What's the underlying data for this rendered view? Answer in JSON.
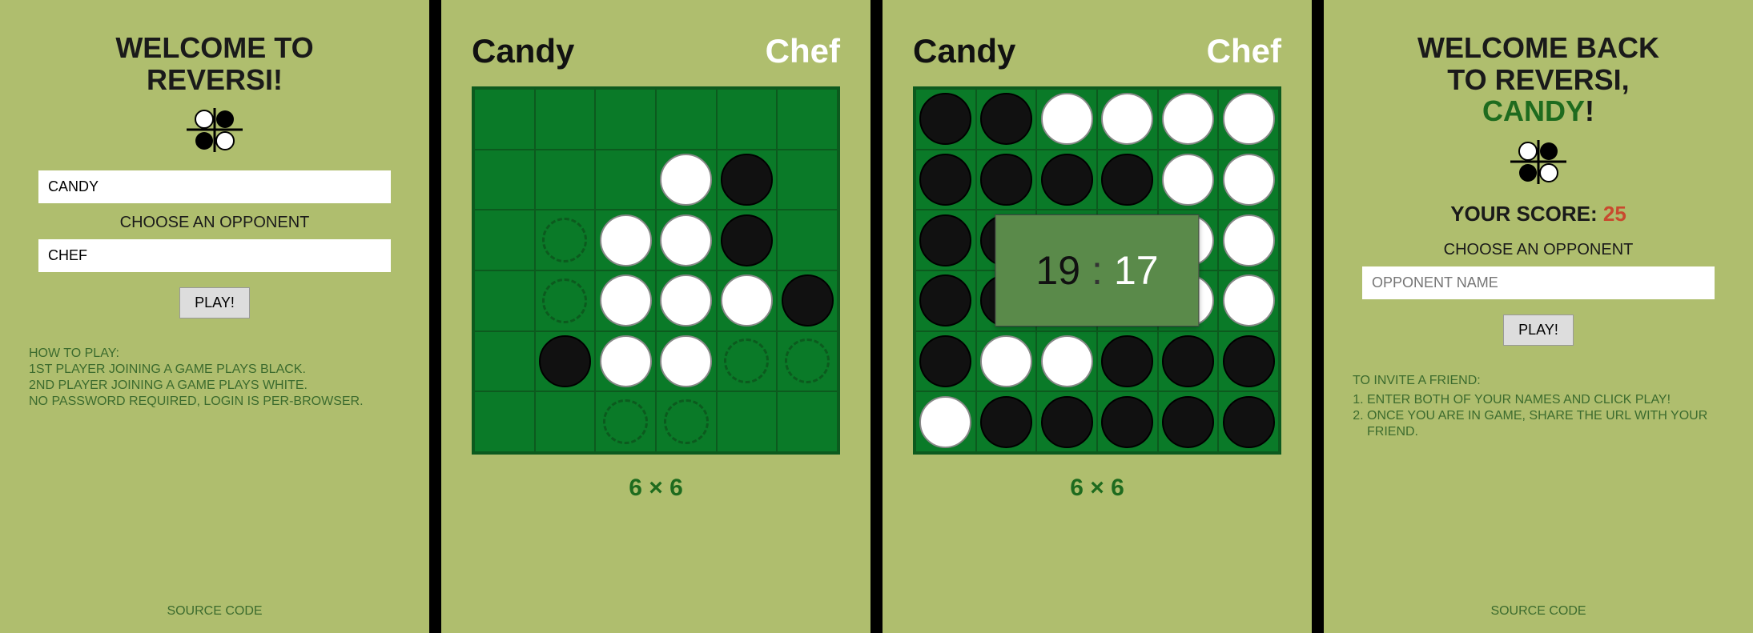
{
  "panel1": {
    "title_l1": "WELCOME TO",
    "title_l2": "REVERSI!",
    "name_value": "CANDY",
    "choose_label": "CHOOSE AN OPPONENT",
    "opp_value": "CHEF",
    "play_label": "PLAY!",
    "howto_title": "HOW TO PLAY:",
    "howto_l1": "1ST PLAYER JOINING A GAME PLAYS BLACK.",
    "howto_l2": "2ND PLAYER JOINING A GAME PLAYS WHITE.",
    "howto_l3": "NO PASSWORD REQUIRED, LOGIN IS PER-BROWSER.",
    "source": "SOURCE CODE"
  },
  "panel2": {
    "p1": "Candy",
    "p2": "Chef",
    "size": "6 × 6",
    "board": [
      [
        "",
        "",
        "",
        "",
        "",
        ""
      ],
      [
        "",
        "",
        "",
        "W",
        "B",
        ""
      ],
      [
        "",
        "h",
        "W",
        "W",
        "B",
        ""
      ],
      [
        "",
        "h",
        "W",
        "W",
        "W",
        "B"
      ],
      [
        "",
        "B",
        "W",
        "W",
        "h",
        "h"
      ],
      [
        "",
        "",
        "h",
        "h",
        "",
        ""
      ]
    ]
  },
  "panel3": {
    "p1": "Candy",
    "p2": "Chef",
    "size": "6 × 6",
    "score1": "19",
    "score2": "17",
    "board": [
      [
        "B",
        "B",
        "W",
        "W",
        "W",
        "W"
      ],
      [
        "B",
        "B",
        "B",
        "B",
        "W",
        "W"
      ],
      [
        "B",
        "B",
        "W",
        "B",
        "W",
        "W"
      ],
      [
        "B",
        "B",
        "B",
        "W",
        "W",
        "W"
      ],
      [
        "B",
        "W",
        "W",
        "B",
        "B",
        "B"
      ],
      [
        "W",
        "B",
        "B",
        "B",
        "B",
        "B"
      ]
    ]
  },
  "panel4": {
    "title_l1": "WELCOME BACK",
    "title_l2": "TO REVERSI,",
    "title_name": "CANDY",
    "title_bang": "!",
    "score_label": "YOUR SCORE: ",
    "score_value": "25",
    "choose_label": "CHOOSE AN OPPONENT",
    "opp_placeholder": "OPPONENT NAME",
    "play_label": "PLAY!",
    "howto_title": "TO INVITE A FRIEND:",
    "howto_1": "ENTER BOTH OF YOUR NAMES AND CLICK PLAY!",
    "howto_2": "ONCE YOU ARE IN GAME, SHARE THE URL WITH YOUR FRIEND.",
    "source": "SOURCE CODE"
  }
}
